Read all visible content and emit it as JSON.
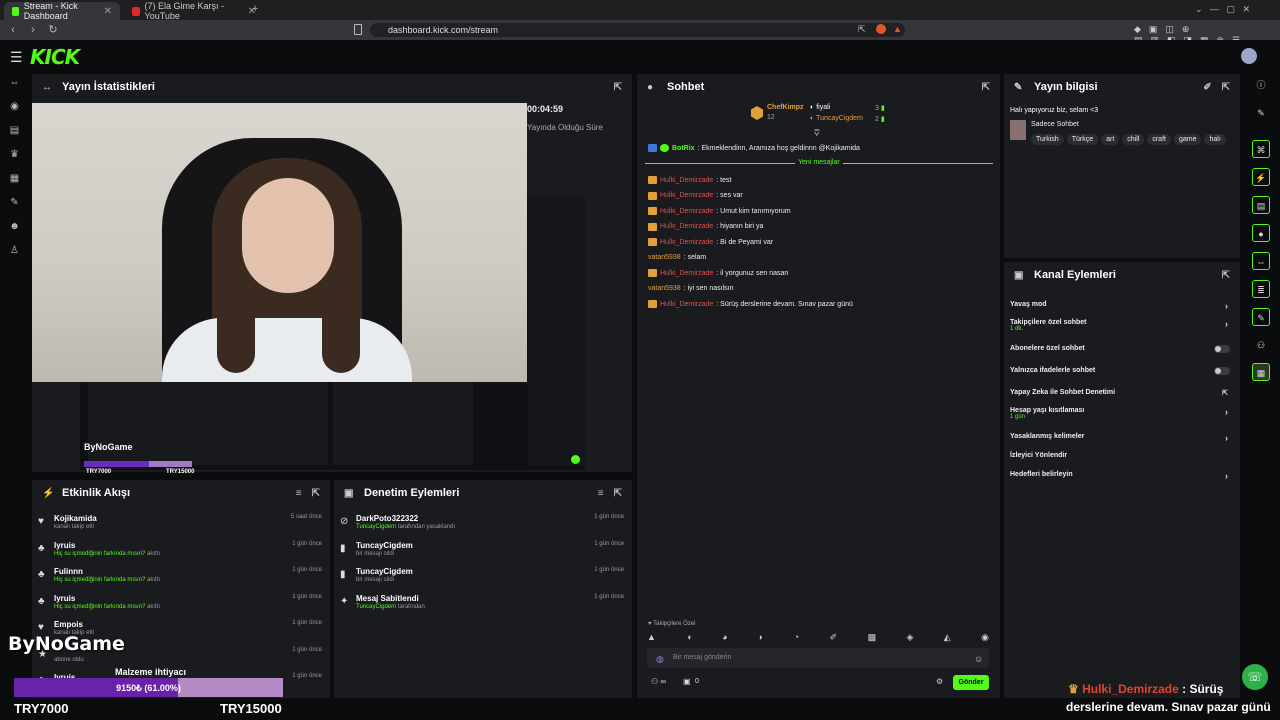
{
  "browser": {
    "tabs": [
      {
        "label": "Stream - Kick Dashboard",
        "active": true
      },
      {
        "label": "(7) Ela Gime Karşı - YouTube",
        "active": false
      }
    ],
    "url": "dashboard.kick.com/stream"
  },
  "brand": {
    "logo": "KICK",
    "accent": "#53fc18"
  },
  "stats": {
    "title": "Yayın İstatistikleri",
    "timer": "00:04:59",
    "timer_label": "Yayında Olduğu Süre"
  },
  "nested": {
    "brand": "ByNoGame",
    "t1": "TRY7000",
    "t2": "TRY15000"
  },
  "feed": {
    "title": "Etkinlik Akışı",
    "rows": [
      {
        "name": "Kojikamida",
        "sub": "kanalı takip etti",
        "hl": "",
        "time": "5 saat önce",
        "icon": "heart-icon"
      },
      {
        "name": "Iyruis",
        "sub": "akıttı",
        "hl": "Hiç su içmediğinin farkında mısın?",
        "time": "1 gün önce",
        "icon": "drop-icon"
      },
      {
        "name": "Fulinnn",
        "sub": "akıttı",
        "hl": "Hiç su içmediğinin farkında mısın?",
        "time": "1 gün önce",
        "icon": "drop-icon"
      },
      {
        "name": "Iyruis",
        "sub": "akıttı",
        "hl": "Hiç su içmediğinin farkında mısın?",
        "time": "1 gün önce",
        "icon": "drop-icon"
      },
      {
        "name": "Empois",
        "sub": "kanalı takip etti",
        "hl": "",
        "time": "1 gün önce",
        "icon": "heart-icon"
      },
      {
        "name": "",
        "sub": "abone oldu",
        "hl": "",
        "time": "1 gün önce",
        "icon": "star-icon"
      },
      {
        "name": "Iyruis",
        "sub": "",
        "hl": "",
        "time": "1 gün önce",
        "icon": "drop-icon"
      }
    ]
  },
  "mod": {
    "title": "Denetim Eylemleri",
    "rows": [
      {
        "name": "DarkPoto322322",
        "hl": "TuncayCigdem",
        "sub": "tarafından yasaklandı",
        "time": "1 gün önce",
        "icon": "ban-icon"
      },
      {
        "name": "TuncayCigdem",
        "hl": "",
        "sub": "bir mesajı sildi",
        "time": "1 gün önce",
        "icon": "trash-icon"
      },
      {
        "name": "TuncayCigdem",
        "hl": "",
        "sub": "bir mesajı sildi",
        "time": "1 gün önce",
        "icon": "trash-icon"
      },
      {
        "name": "Mesaj Sabitlendi",
        "hl": "TuncayCigdem",
        "sub": "tarafından",
        "time": "1 gün önce",
        "icon": "pin-icon"
      }
    ]
  },
  "chat": {
    "title": "Sohbet",
    "top": {
      "user1": "ChefKimpz",
      "count1": "12",
      "user2": "fiyali",
      "c2": "3",
      "user3": "TuncayCigdem",
      "c3": "2"
    },
    "pinned": {
      "user": "BotRix",
      "text": ": Ekmeklendinn, Aramıza hoş geldinnn @Kojikamida"
    },
    "new_label": "Yeni mesajlar",
    "messages": [
      {
        "user": "Hulki_Demirzade",
        "text": ": test",
        "badge": true,
        "cls": "uname"
      },
      {
        "user": "Hulki_Demirzade",
        "text": ": ses var",
        "badge": true,
        "cls": "uname"
      },
      {
        "user": "Hulki_Demirzade",
        "text": ": Umut kim tanımıyorum",
        "badge": true,
        "cls": "uname"
      },
      {
        "user": "Hulki_Demirzade",
        "text": ": hiyanın biri ya",
        "badge": true,
        "cls": "uname"
      },
      {
        "user": "Hulki_Demirzade",
        "text": ": Bi de Peyami var",
        "badge": true,
        "cls": "uname"
      },
      {
        "user": "vatan5938",
        "text": ": selam",
        "badge": false,
        "cls": "uname b"
      },
      {
        "user": "Hulki_Demirzade",
        "text": ": il yorgunuz sen nasan",
        "badge": true,
        "cls": "uname"
      },
      {
        "user": "vatan5938",
        "text": ": iyi sen nasılsın",
        "badge": false,
        "cls": "uname b"
      },
      {
        "user": "Hulki_Demirzade",
        "text": ": Sürüş derslerine devam. Sınav pazar günü",
        "badge": true,
        "cls": "uname"
      }
    ],
    "followers_only": "Takipçilere Özel",
    "placeholder": "Bir mesaj gönderin",
    "count": "0",
    "send": "Gönder"
  },
  "info": {
    "title": "Yayın bilgisi",
    "stream_title": "Halı yapıyoruz biz, selam <3",
    "category": "Sadece Sohbet",
    "tags": [
      "Turkish",
      "Türkçe",
      "art",
      "chill",
      "craft",
      "game",
      "halı"
    ]
  },
  "actions": {
    "title": "Kanal Eylemleri",
    "items": [
      {
        "label": "Yavaş mod",
        "sub": "",
        "kind": "chev"
      },
      {
        "label": "Takipçilere özel sohbet",
        "sub": "1 dk.",
        "kind": "chev"
      },
      {
        "label": "Abonelere özel sohbet",
        "sub": "",
        "kind": "toggle"
      },
      {
        "label": "Yalnızca ifadelerle sohbet",
        "sub": "",
        "kind": "toggle"
      },
      {
        "label": "Yapay Zeka ile Sohbet Denetimi",
        "sub": "",
        "kind": "ext"
      },
      {
        "label": "Hesap yaşı kısıtlaması",
        "sub": "1 gün",
        "kind": "chev"
      },
      {
        "label": "Yasaklanmış kelimeler",
        "sub": "",
        "kind": "chev"
      },
      {
        "label": "İzleyici Yönlendir",
        "sub": "",
        "kind": "none"
      },
      {
        "label": "Hedefleri belirleyin",
        "sub": "",
        "kind": "chev"
      }
    ]
  },
  "overlay": {
    "brand": "ByNoGame",
    "goal_label": "Malzeme ihtiyacı",
    "bar_text": "9150₺ (61.00%)",
    "progress": 0.61,
    "left": "TRY7000",
    "right": "TRY15000",
    "chat_user": "Hulki_Demirzade",
    "chat_text1": " : Sürüş",
    "chat_text2": "derslerine devam. Sınav pazar günü"
  }
}
